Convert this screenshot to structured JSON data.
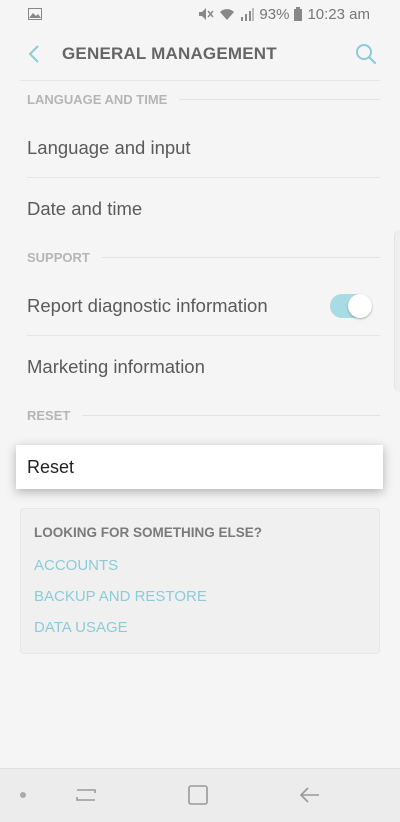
{
  "status_bar": {
    "battery": "93%",
    "time": "10:23 am"
  },
  "header": {
    "title": "GENERAL MANAGEMENT",
    "back_icon": "chevron-left-icon",
    "search_icon": "search-icon"
  },
  "sections": {
    "language_time": {
      "header": "LANGUAGE AND TIME",
      "items": [
        "Language and input",
        "Date and time"
      ]
    },
    "support": {
      "header": "SUPPORT",
      "items": [
        "Report diagnostic information",
        "Marketing information"
      ],
      "report_toggle_on": true
    },
    "reset": {
      "header": "RESET",
      "item": "Reset"
    }
  },
  "suggestions": {
    "title": "LOOKING FOR SOMETHING ELSE?",
    "links": [
      "ACCOUNTS",
      "BACKUP AND RESTORE",
      "DATA USAGE"
    ]
  },
  "colors": {
    "accent": "#8ccbd8",
    "toggle_track": "#a8dbe4",
    "background": "#f5f5f5"
  }
}
